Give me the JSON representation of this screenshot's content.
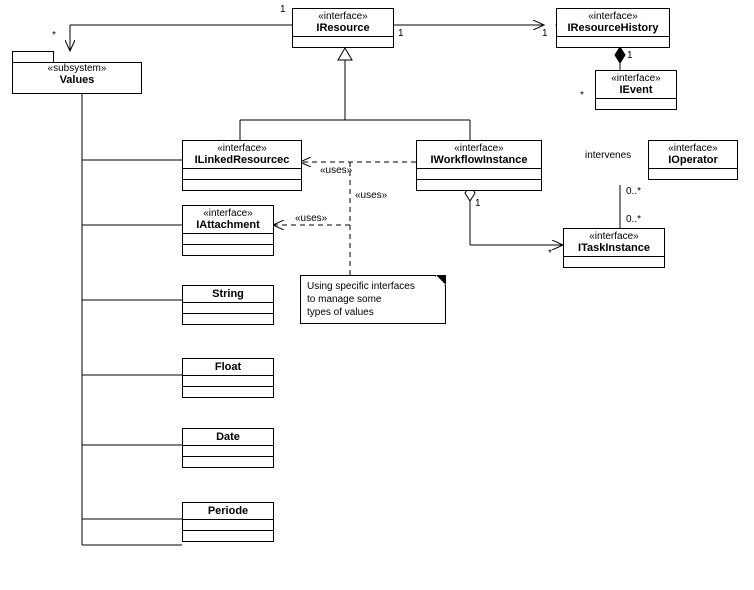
{
  "stereo_subsystem": "«subsystem»",
  "stereo_interface": "«interface»",
  "values_name": "Values",
  "iresource": "IResource",
  "iresourcehistory": "IResourceHistory",
  "ievent": "IEvent",
  "ilinkedresource": "ILinkedResourcec",
  "iworkflowinstance": "IWorkflowInstance",
  "ioperator": "IOperator",
  "iattachment": "IAttachment",
  "itaskinstance": "ITaskInstance",
  "string_name": "String",
  "float_name": "Float",
  "date_name": "Date",
  "periode_name": "Periode",
  "note_l1": "Using specific interfaces",
  "note_l2": "to manage some",
  "note_l3": "types of values",
  "uses": "«uses»",
  "intervenes": "intervenes",
  "m1": "1",
  "mstar": "*",
  "m01star": "0..*",
  "m0star": "0..*"
}
